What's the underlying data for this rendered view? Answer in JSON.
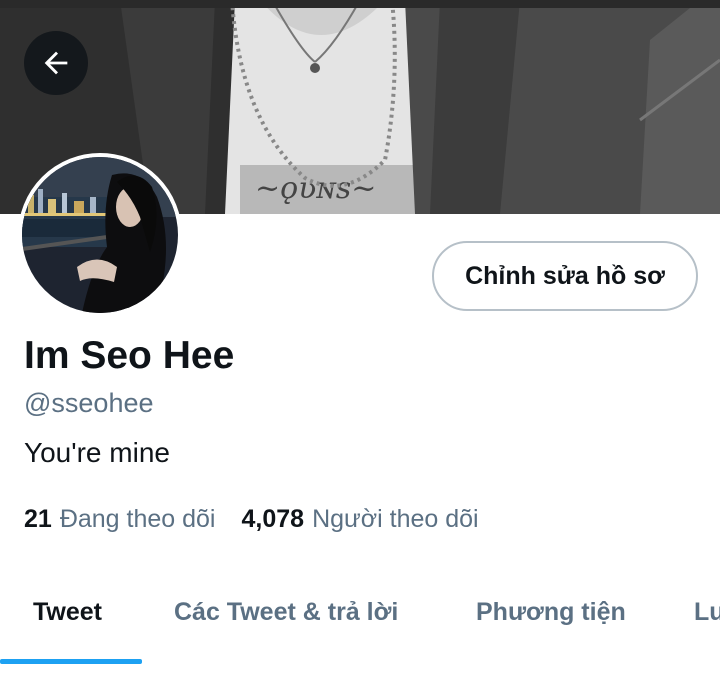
{
  "header": {
    "back_icon": "arrow-left-icon"
  },
  "profile": {
    "name": "Im Seo Hee",
    "handle": "@sseohee",
    "bio": "You're mine",
    "edit_button_label": "Chỉnh sửa hồ sơ"
  },
  "stats": {
    "following_count": "21",
    "following_label": "Đang theo dõi",
    "followers_count": "4,078",
    "followers_label": "Người theo dõi"
  },
  "tabs": [
    {
      "label": "Tweet",
      "active": true
    },
    {
      "label": "Các Tweet & trả lời",
      "active": false
    },
    {
      "label": "Phương tiện",
      "active": false
    },
    {
      "label": "Lư",
      "active": false
    }
  ],
  "colors": {
    "accent": "#1da1f2",
    "text_primary": "#0f1419",
    "text_secondary": "#5b7083"
  }
}
